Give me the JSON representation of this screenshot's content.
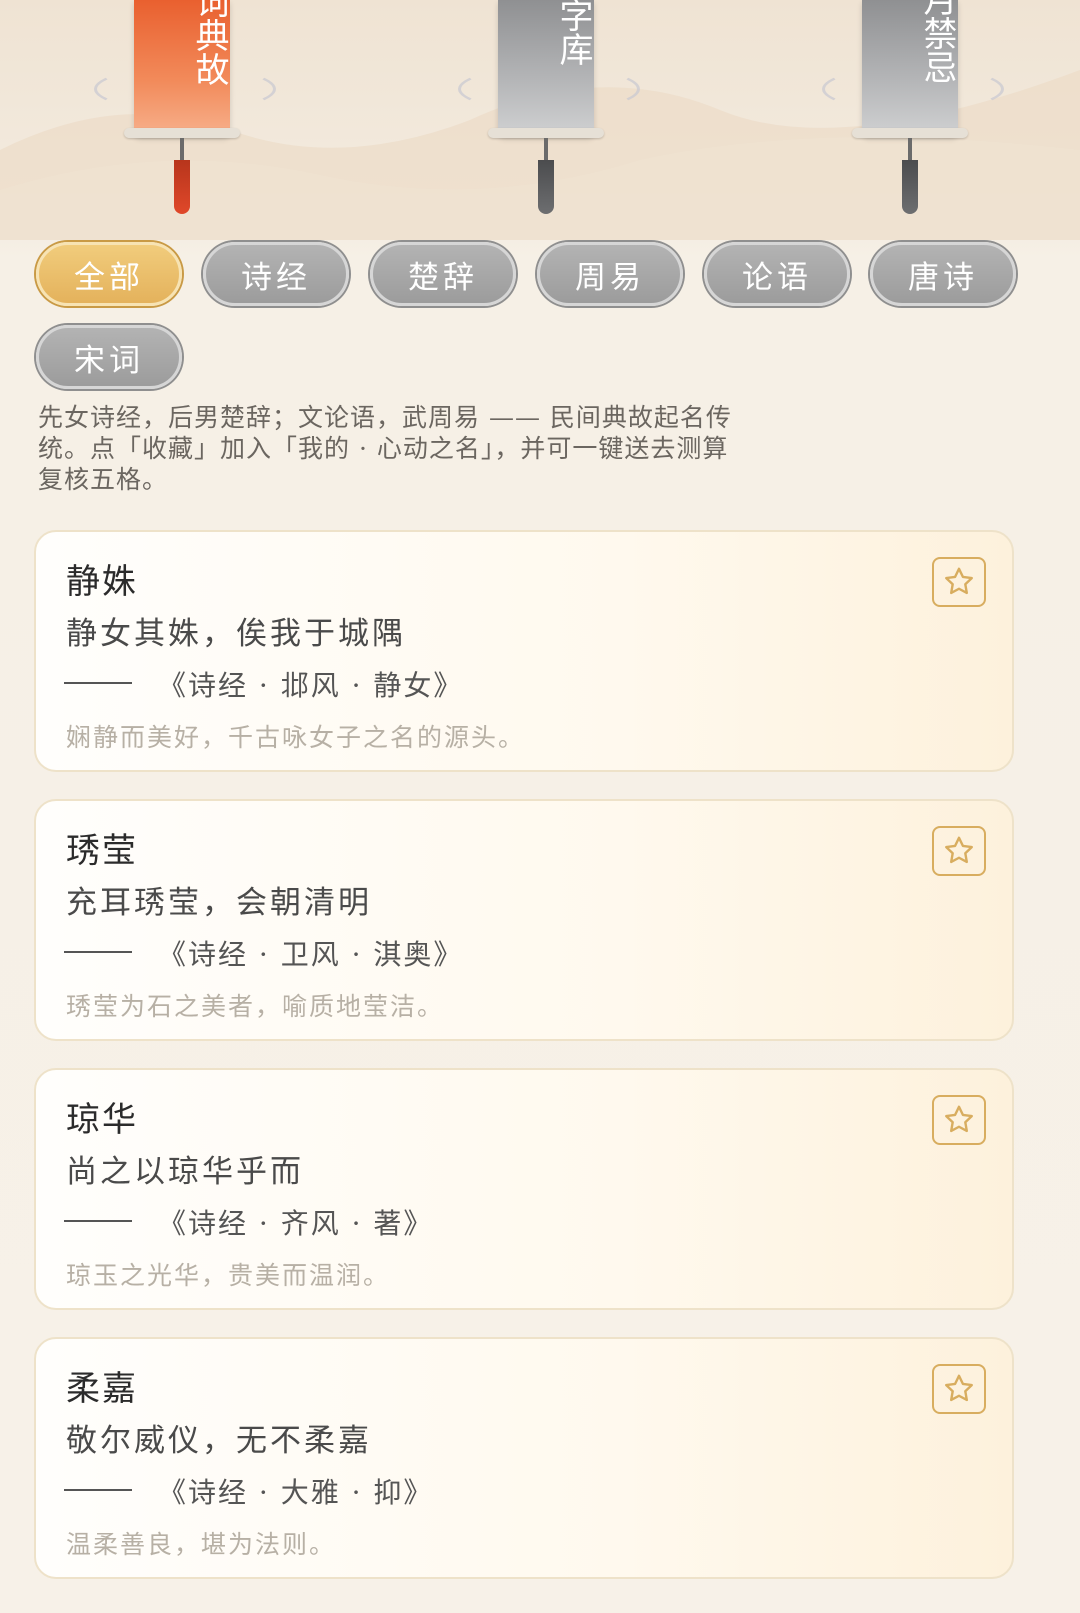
{
  "banners": [
    {
      "text": "词典故",
      "state": "active"
    },
    {
      "text": "字库",
      "state": "inactive"
    },
    {
      "text": "月禁忌",
      "state": "inactive"
    }
  ],
  "filters": [
    {
      "label": "全部",
      "active": true
    },
    {
      "label": "诗经",
      "active": false
    },
    {
      "label": "楚辞",
      "active": false
    },
    {
      "label": "周易",
      "active": false
    },
    {
      "label": "论语",
      "active": false
    },
    {
      "label": "唐诗",
      "active": false
    },
    {
      "label": "宋词",
      "active": false
    }
  ],
  "intro": {
    "line1": "先女诗经，后男楚辞；文论语，武周易 —— 民间典故起名传",
    "line2": "统。点「收藏」加入「我的 · 心动之名」，并可一键送去测算",
    "line3": "复核五格。"
  },
  "cards": [
    {
      "name": "静姝",
      "verse": "静女其姝，俟我于城隅",
      "dash": "——",
      "source": "《诗经 · 邶风 · 静女》",
      "desc": "娴静而美好，千古咏女子之名的源头。",
      "favorite_icon": "star-icon"
    },
    {
      "name": "琇莹",
      "verse": "充耳琇莹，会朝清明",
      "dash": "——",
      "source": "《诗经 · 卫风 · 淇奥》",
      "desc": "琇莹为石之美者，喻质地莹洁。",
      "favorite_icon": "star-icon"
    },
    {
      "name": "琼华",
      "verse": "尚之以琼华乎而",
      "dash": "——",
      "source": "《诗经 · 齐风 · 著》",
      "desc": "琼玉之光华，贵美而温润。",
      "favorite_icon": "star-icon"
    },
    {
      "name": "柔嘉",
      "verse": "敬尔威仪，无不柔嘉",
      "dash": "——",
      "source": "《诗经 · 大雅 · 抑》",
      "desc": "温柔善良，堪为法则。",
      "favorite_icon": "star-icon"
    }
  ],
  "colors": {
    "accent_gold": "#e4b25c",
    "active_banner": "#e9602f",
    "inactive_gray": "#a5a5a5"
  }
}
